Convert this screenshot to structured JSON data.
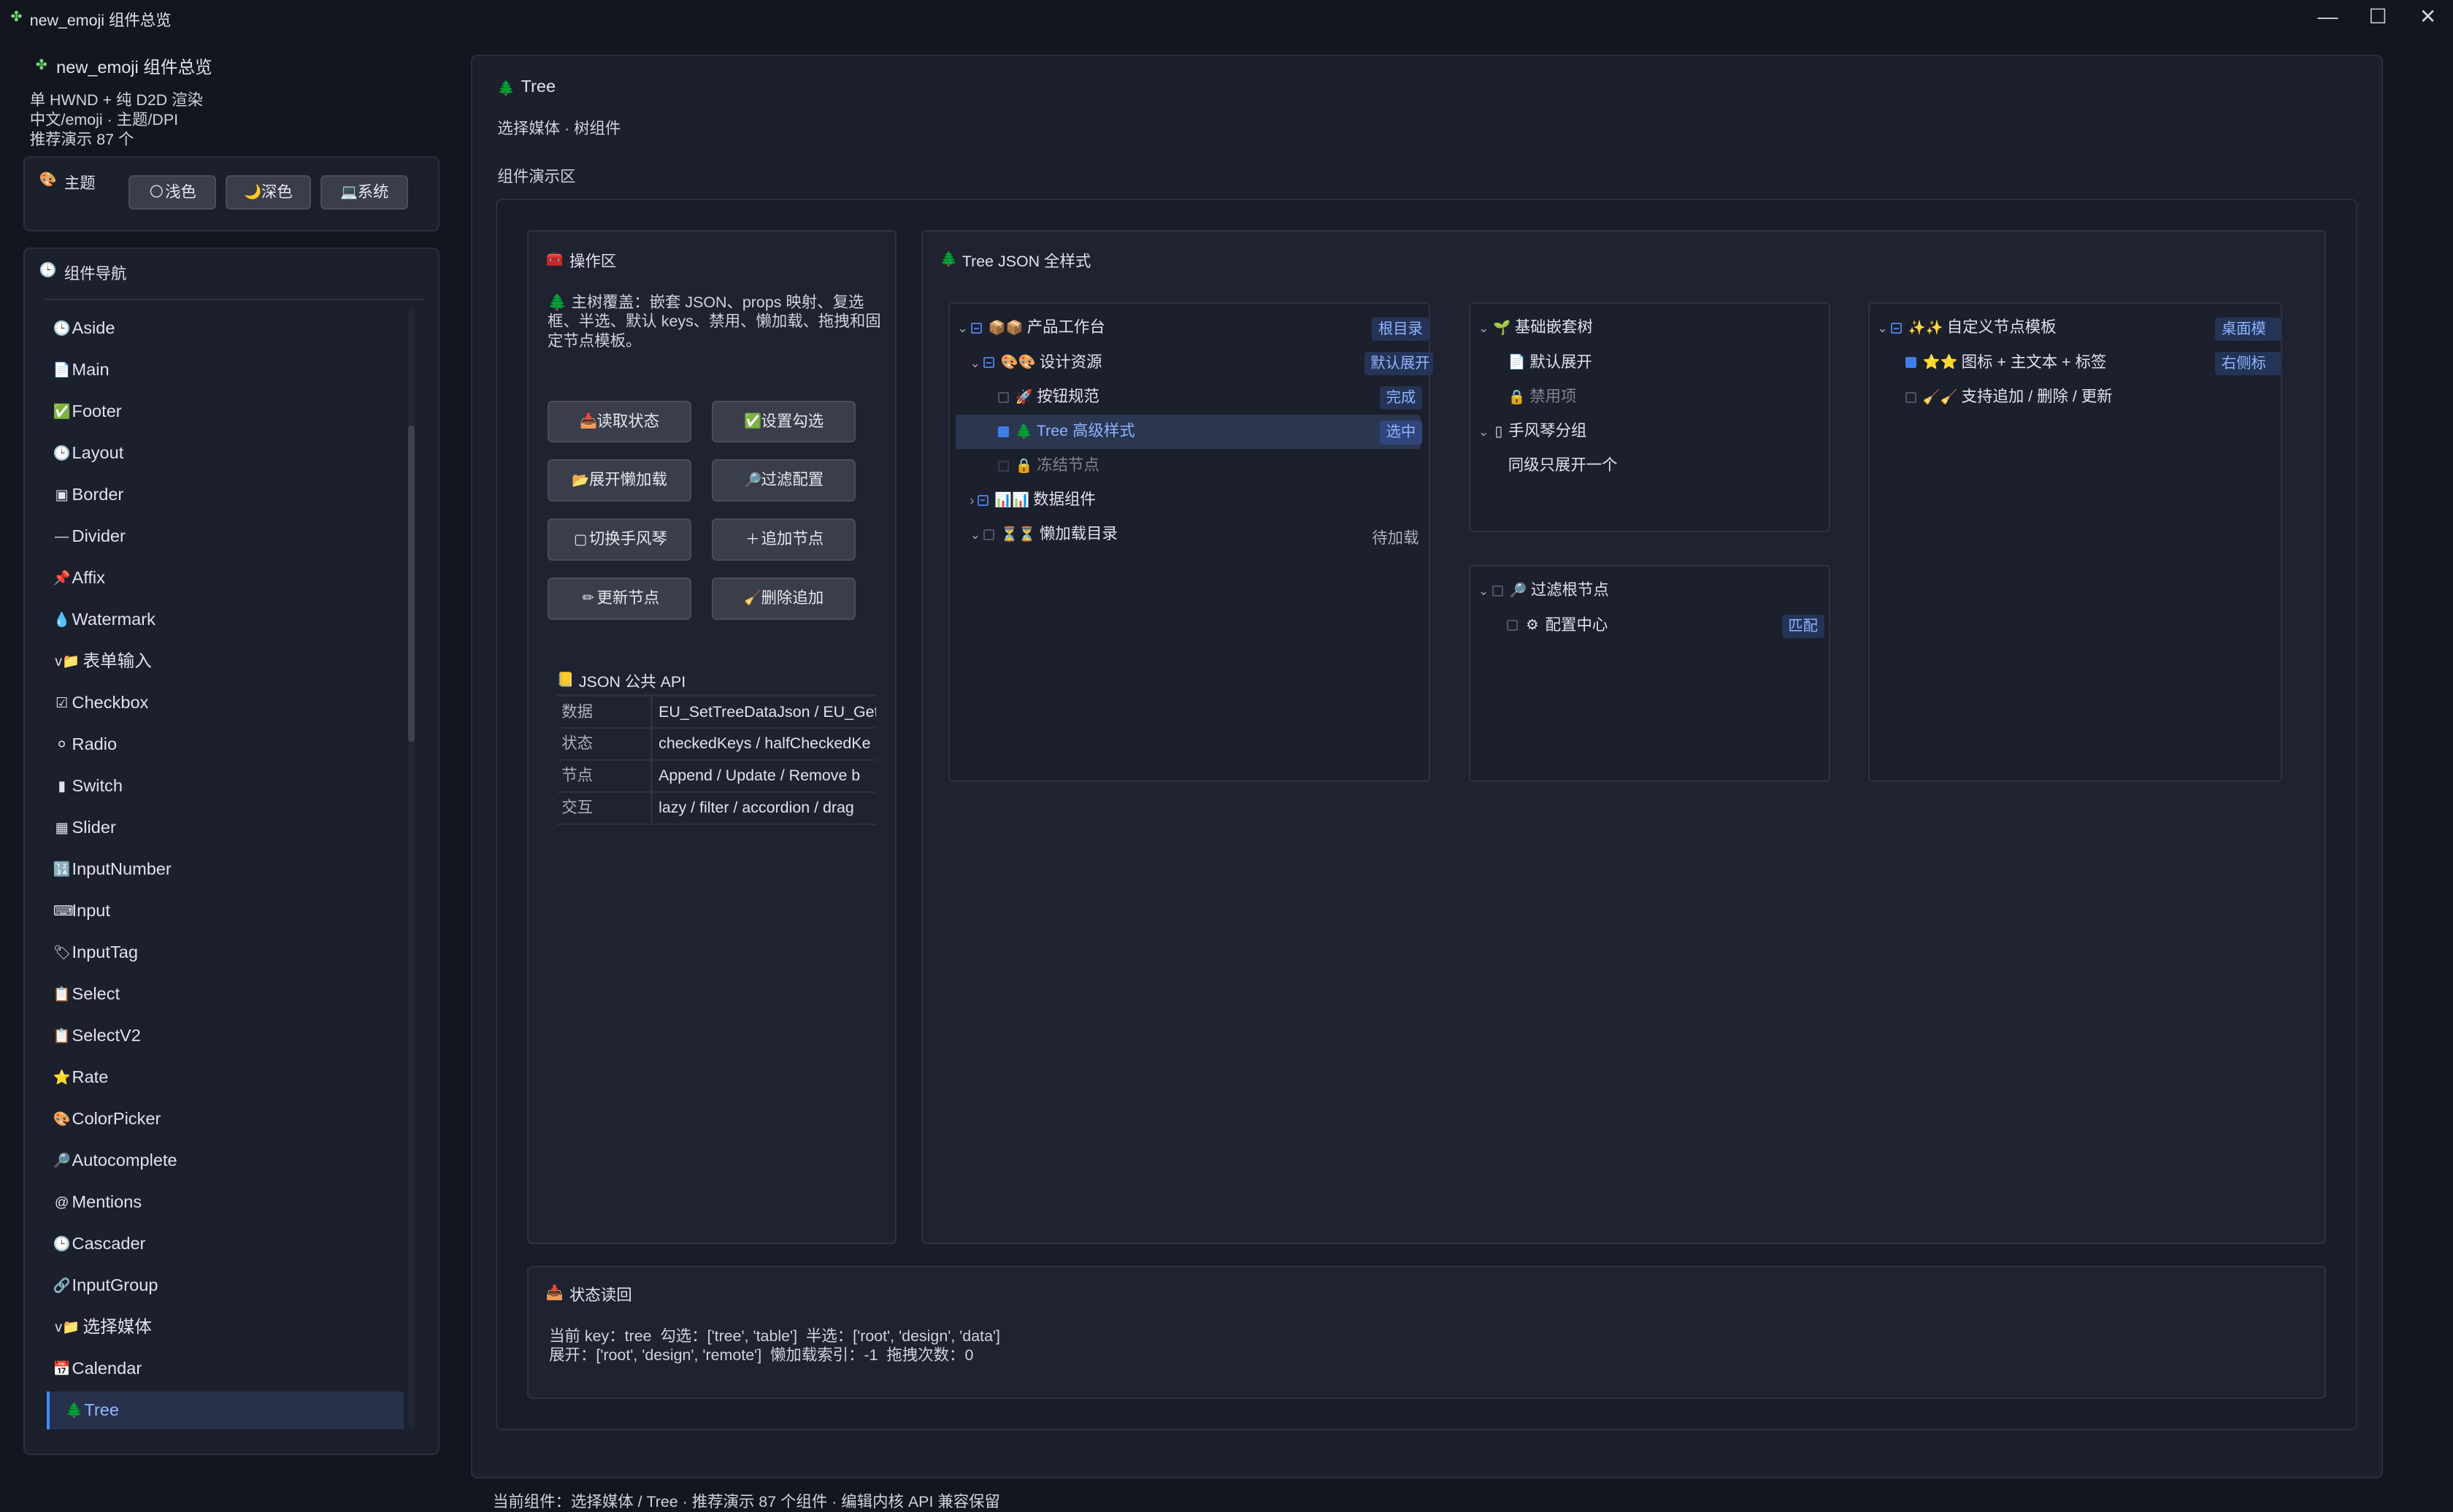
{
  "window": {
    "title": "new_emoji 组件总览",
    "icon": "sparkle-icon",
    "controls": {
      "minimize": "—",
      "maximize": "☐",
      "close": "✕"
    }
  },
  "sidebar": {
    "app_title": "new_emoji 组件总览",
    "info_lines": [
      "单 HWND + 纯 D2D 渲染",
      "中文/emoji · 主题/DPI",
      "推荐演示 87 个"
    ],
    "theme": {
      "label": "主题",
      "buttons": [
        {
          "icon": "🌕",
          "label": "浅色"
        },
        {
          "icon": "🌙",
          "label": "深色"
        },
        {
          "icon": "💻",
          "label": "系统"
        }
      ]
    },
    "nav": {
      "label": "组件导航",
      "items": [
        {
          "icon": "🕒",
          "label": "Aside"
        },
        {
          "icon": "📄",
          "label": "Main"
        },
        {
          "icon": "✅",
          "label": "Footer"
        },
        {
          "icon": "🕒",
          "label": "Layout"
        },
        {
          "icon": "▣",
          "label": "Border"
        },
        {
          "icon": "—",
          "label": "Divider"
        },
        {
          "icon": "📌",
          "label": "Affix"
        },
        {
          "icon": "💧",
          "label": "Watermark"
        },
        {
          "icon": "v📁",
          "label": "表单输入"
        },
        {
          "icon": "☑",
          "label": "Checkbox"
        },
        {
          "icon": "⚪",
          "label": "Radio"
        },
        {
          "icon": "▮",
          "label": "Switch"
        },
        {
          "icon": "▦",
          "label": "Slider"
        },
        {
          "icon": "🔢",
          "label": "InputNumber"
        },
        {
          "icon": "⌨",
          "label": "Input"
        },
        {
          "icon": "🏷",
          "label": "InputTag"
        },
        {
          "icon": "📋",
          "label": "Select"
        },
        {
          "icon": "📋",
          "label": "SelectV2"
        },
        {
          "icon": "⭐",
          "label": "Rate"
        },
        {
          "icon": "🎨",
          "label": "ColorPicker"
        },
        {
          "icon": "🔎",
          "label": "Autocomplete"
        },
        {
          "icon": "@",
          "label": "Mentions"
        },
        {
          "icon": "🕒",
          "label": "Cascader"
        },
        {
          "icon": "🔗",
          "label": "InputGroup"
        },
        {
          "icon": "v📁",
          "label": "选择媒体"
        },
        {
          "icon": "📅",
          "label": "Calendar"
        },
        {
          "icon": "🌲",
          "label": "Tree"
        }
      ]
    }
  },
  "main": {
    "icon": "🌲",
    "title": "Tree",
    "subtitle": "选择媒体 · 树组件",
    "demo_label": "组件演示区",
    "ops": {
      "title": "操作区",
      "title_icon": "🧰",
      "description": "🌲 主树覆盖：嵌套 JSON、props 映射、复选框、半选、默认 keys、禁用、懒加载、拖拽和固定节点模板。",
      "buttons": [
        {
          "icon": "📥",
          "label": "读取状态"
        },
        {
          "icon": "✅",
          "label": "设置勾选"
        },
        {
          "icon": "📂",
          "label": "展开懒加载"
        },
        {
          "icon": "🔎",
          "label": "过滤配置"
        },
        {
          "icon": "▢",
          "label": "切换手风琴"
        },
        {
          "icon": "＋",
          "label": "追加节点"
        },
        {
          "icon": "✏",
          "label": "更新节点"
        },
        {
          "icon": "🧹",
          "label": "删除追加"
        }
      ],
      "api": {
        "title": "JSON 公共 API",
        "rows": [
          {
            "key": "数据",
            "value": "EU_SetTreeDataJson / EU_Get"
          },
          {
            "key": "状态",
            "value": "checkedKeys / halfCheckedKe"
          },
          {
            "key": "节点",
            "value": "Append / Update / Remove b"
          },
          {
            "key": "交互",
            "value": "lazy / filter / accordion / drag"
          }
        ]
      }
    },
    "tree_panel": {
      "title": "Tree JSON 全样式",
      "main_tree": [
        {
          "icon": "📦📦",
          "label": "产品工作台",
          "tag": "根目录"
        },
        {
          "icon": "🎨🎨",
          "label": "设计资源",
          "tag": "默认展开"
        },
        {
          "icon": "🚀",
          "label": "按钮规范",
          "tag": "完成"
        },
        {
          "icon": "🌲",
          "label": "Tree 高级样式",
          "tag": "选中"
        },
        {
          "icon": "🔒",
          "label": "冻结节点"
        },
        {
          "icon": "📊📊",
          "label": "数据组件"
        },
        {
          "icon": "⏳⏳",
          "label": "懒加载目录",
          "tag": "待加载"
        }
      ],
      "basic_tree": [
        {
          "icon": "🌱",
          "label": "基础嵌套树"
        },
        {
          "icon": "📄",
          "label": "默认展开"
        },
        {
          "icon": "🔒",
          "label": "禁用项"
        },
        {
          "icon": "▯",
          "label": "手风琴分组"
        },
        {
          "label": "同级只展开一个"
        }
      ],
      "filter_tree": [
        {
          "icon": "🔎",
          "label": "过滤根节点"
        },
        {
          "icon": "⚙",
          "label": "配置中心",
          "tag": "匹配"
        }
      ],
      "custom_tree": [
        {
          "icon": "✨✨",
          "label": "自定义节点模板",
          "tag": "桌面模板"
        },
        {
          "icon": "⭐⭐",
          "label": "图标 + 主文本 + 标签",
          "tag": "右侧标签"
        },
        {
          "icon": "🧹🧹",
          "label": "支持追加 / 删除 / 更新"
        }
      ]
    },
    "status": {
      "title": "状态读回",
      "title_icon": "📥",
      "line1": "当前 key：tree  勾选：['tree', 'table']  半选：['root', 'design', 'data']",
      "line2": "展开：['root', 'design', 'remote']  懒加载索引：-1  拖拽次数：0"
    }
  },
  "footer": {
    "text": "当前组件：选择媒体 / Tree · 推荐演示 87 个组件 · 编辑内核 API 兼容保留"
  }
}
